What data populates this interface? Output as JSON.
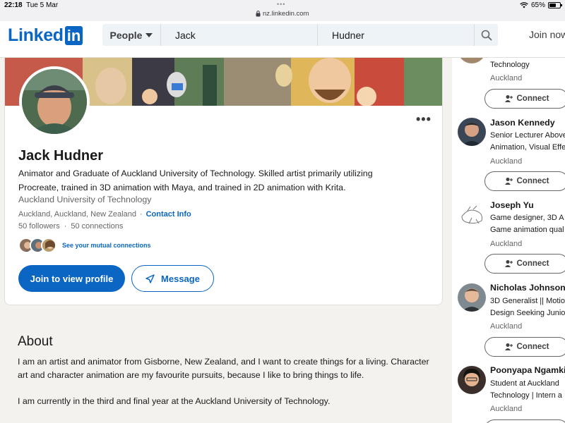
{
  "status_bar": {
    "time": "22:18",
    "date": "Tue 5 Mar",
    "url": "nz.linkedin.com",
    "battery": "65%"
  },
  "header": {
    "logo_text": "Linked",
    "logo_box": "in",
    "search_type": "People",
    "first_name": "Jack",
    "last_name": "Hudner",
    "join_now": "Join now"
  },
  "profile": {
    "name": "Jack Hudner",
    "headline": "Animator and Graduate of Auckland University of Technology. Skilled artist primarily utilizing Procreate, trained in 3D animation with Maya, and trained in 2D animation with Krita.",
    "school": "Auckland University of Technology",
    "location": "Auckland, Auckland, New Zealand",
    "separator": "·",
    "contact_info": "Contact Info",
    "followers": "50 followers",
    "connections": "50 connections",
    "mutual": "See your mutual connections",
    "join_button": "Join to view profile",
    "message_button": "Message"
  },
  "about": {
    "title": "About",
    "p1": "I am an artist and animator from Gisborne, New Zealand, and I want to create things for a living. Character art and character animation are my favourite pursuits, because I like to bring things to life.",
    "p2": "I am currently in the third and final year at the Auckland University of Technology."
  },
  "sidebar": {
    "connect_label": "Connect",
    "people": [
      {
        "name": "",
        "title_lines": [
          "Technology"
        ],
        "location": "Auckland"
      },
      {
        "name": "Jason Kennedy",
        "title_lines": [
          "Senior Lecturer Above",
          "Animation, Visual Effe"
        ],
        "location": "Auckland"
      },
      {
        "name": "Joseph Yu",
        "title_lines": [
          "Game designer, 3D A",
          "Game animation qual"
        ],
        "location": "Auckland"
      },
      {
        "name": "Nicholas Johnson",
        "title_lines": [
          "3D Generalist || Motio",
          "Design Seeking Junio"
        ],
        "location": "Auckland"
      },
      {
        "name": "Poonyapa Ngamki",
        "title_lines": [
          "Student at Auckland",
          "Technology | Intern a"
        ],
        "location": "Auckland"
      }
    ]
  },
  "colors": {
    "brand": "#0a66c2",
    "background": "#f4f2ee"
  }
}
